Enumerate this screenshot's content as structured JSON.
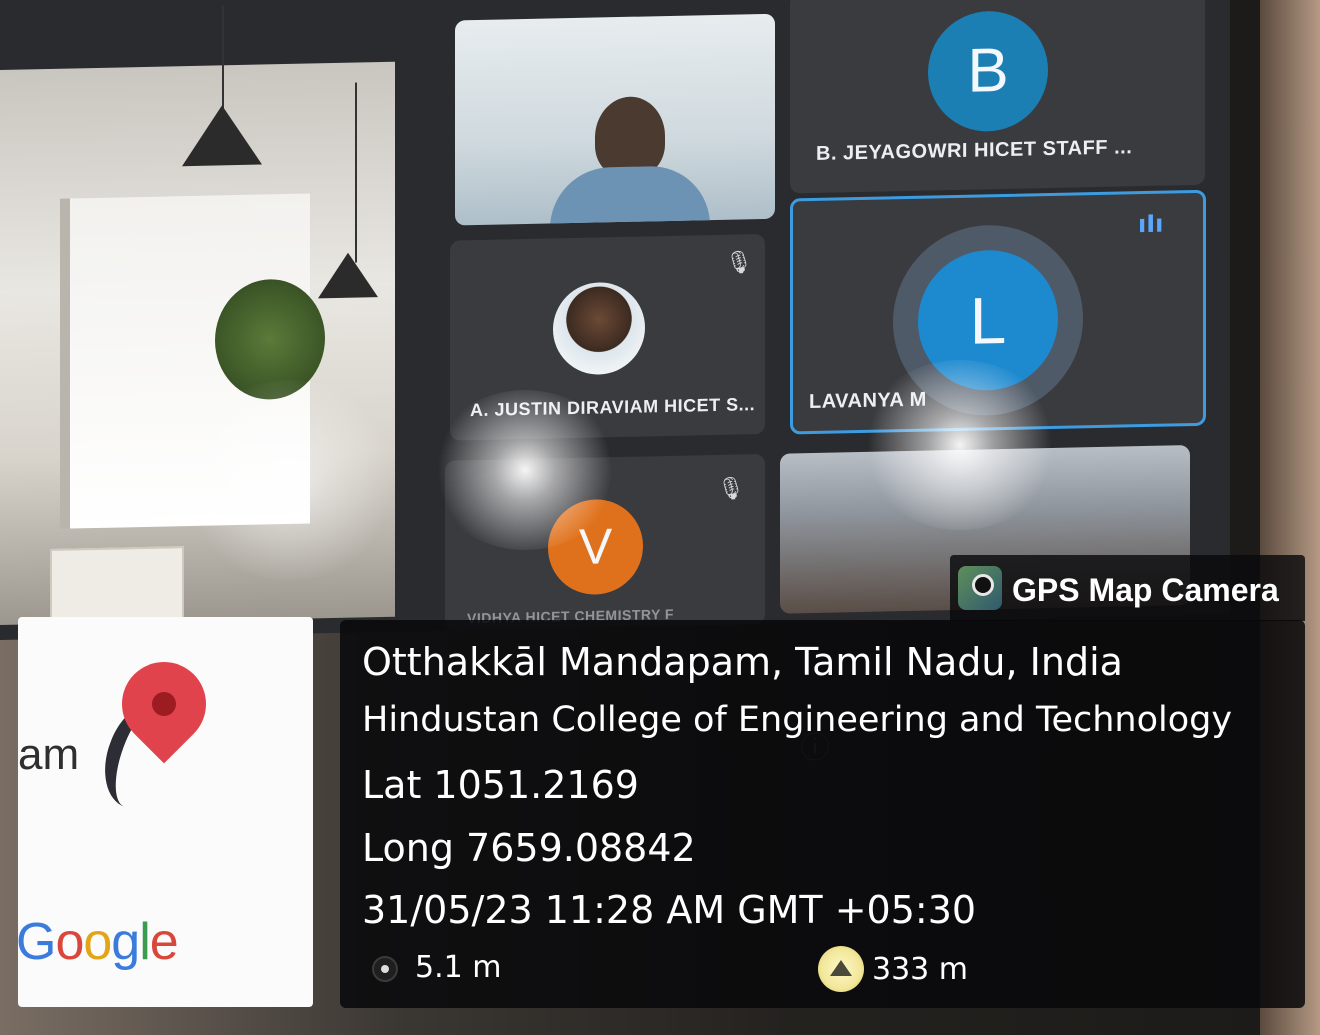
{
  "meeting": {
    "participants": [
      {
        "id": "b",
        "initial": "B",
        "name": "B. JEYAGOWRI HICET STAFF ...",
        "color": "#1c7fb4"
      },
      {
        "id": "justin",
        "name": "A. JUSTIN DIRAVIAM HICET S..."
      },
      {
        "id": "l",
        "initial": "L",
        "name": "LAVANYA M",
        "color": "#1d89cf"
      },
      {
        "id": "v",
        "initial": "V",
        "name": "VIDHYA HICET CHEMISTRY F",
        "color": "#e0711c"
      }
    ]
  },
  "gps_overlay": {
    "brand": "GPS Map Camera",
    "place": "Otthakkāl Mandapam, Tamil Nadu, India",
    "site": "Hindustan College of Engineering and Technology",
    "lat": "Lat 1051.2169",
    "long": "Long 7659.08842",
    "datetime": "31/05/23 11:28 AM GMT +05:30",
    "accuracy": "5.1 m",
    "altitude": "333 m"
  },
  "map_card": {
    "partial_label": "am",
    "google_letters": [
      "G",
      "o",
      "o",
      "g",
      "l",
      "e"
    ]
  }
}
